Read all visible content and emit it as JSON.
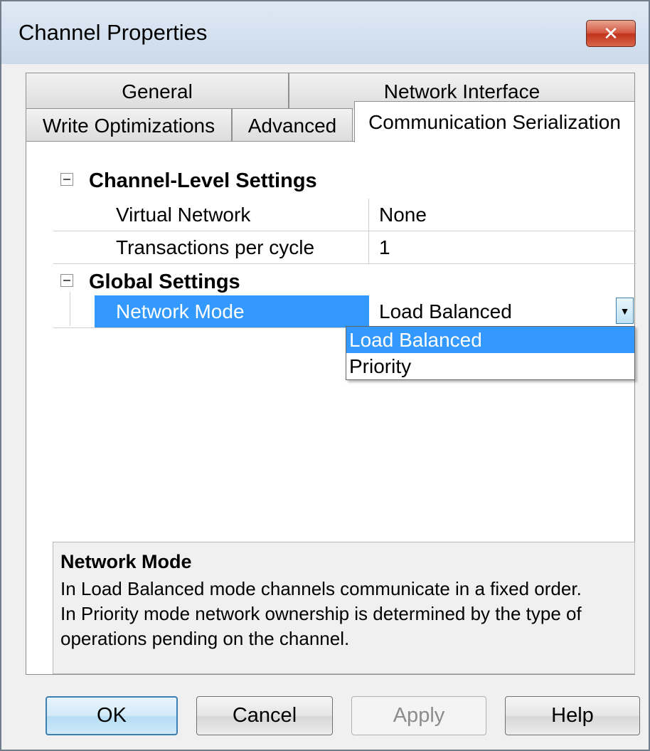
{
  "window": {
    "title": "Channel Properties",
    "close_glyph": "✕"
  },
  "tabs": {
    "general": "General",
    "network_interface": "Network Interface",
    "write_optimizations": "Write Optimizations",
    "advanced": "Advanced",
    "communication_serialization": "Communication Serialization"
  },
  "active_tab": "Communication Serialization",
  "grid": {
    "channel_level": {
      "title": "Channel-Level Settings",
      "virtual_network": {
        "name": "Virtual Network",
        "value": "None"
      },
      "transactions_per_cycle": {
        "name": "Transactions per cycle",
        "value": "1"
      }
    },
    "global": {
      "title": "Global Settings",
      "network_mode": {
        "name": "Network Mode",
        "value": "Load Balanced"
      }
    }
  },
  "dropdown": {
    "options": [
      "Load Balanced",
      "Priority"
    ],
    "selected": "Load Balanced",
    "arrow_icon": "chevron-down-icon"
  },
  "description": {
    "title": "Network Mode",
    "line1": "In Load Balanced mode channels communicate in a fixed order.",
    "line2": "In Priority mode network ownership is determined by the type of",
    "line3": "operations pending on the channel."
  },
  "buttons": {
    "ok": "OK",
    "cancel": "Cancel",
    "apply": "Apply",
    "help": "Help"
  },
  "colors": {
    "selection": "#3399ff",
    "titlebar": "#cbdaea",
    "close": "#c0331c"
  }
}
